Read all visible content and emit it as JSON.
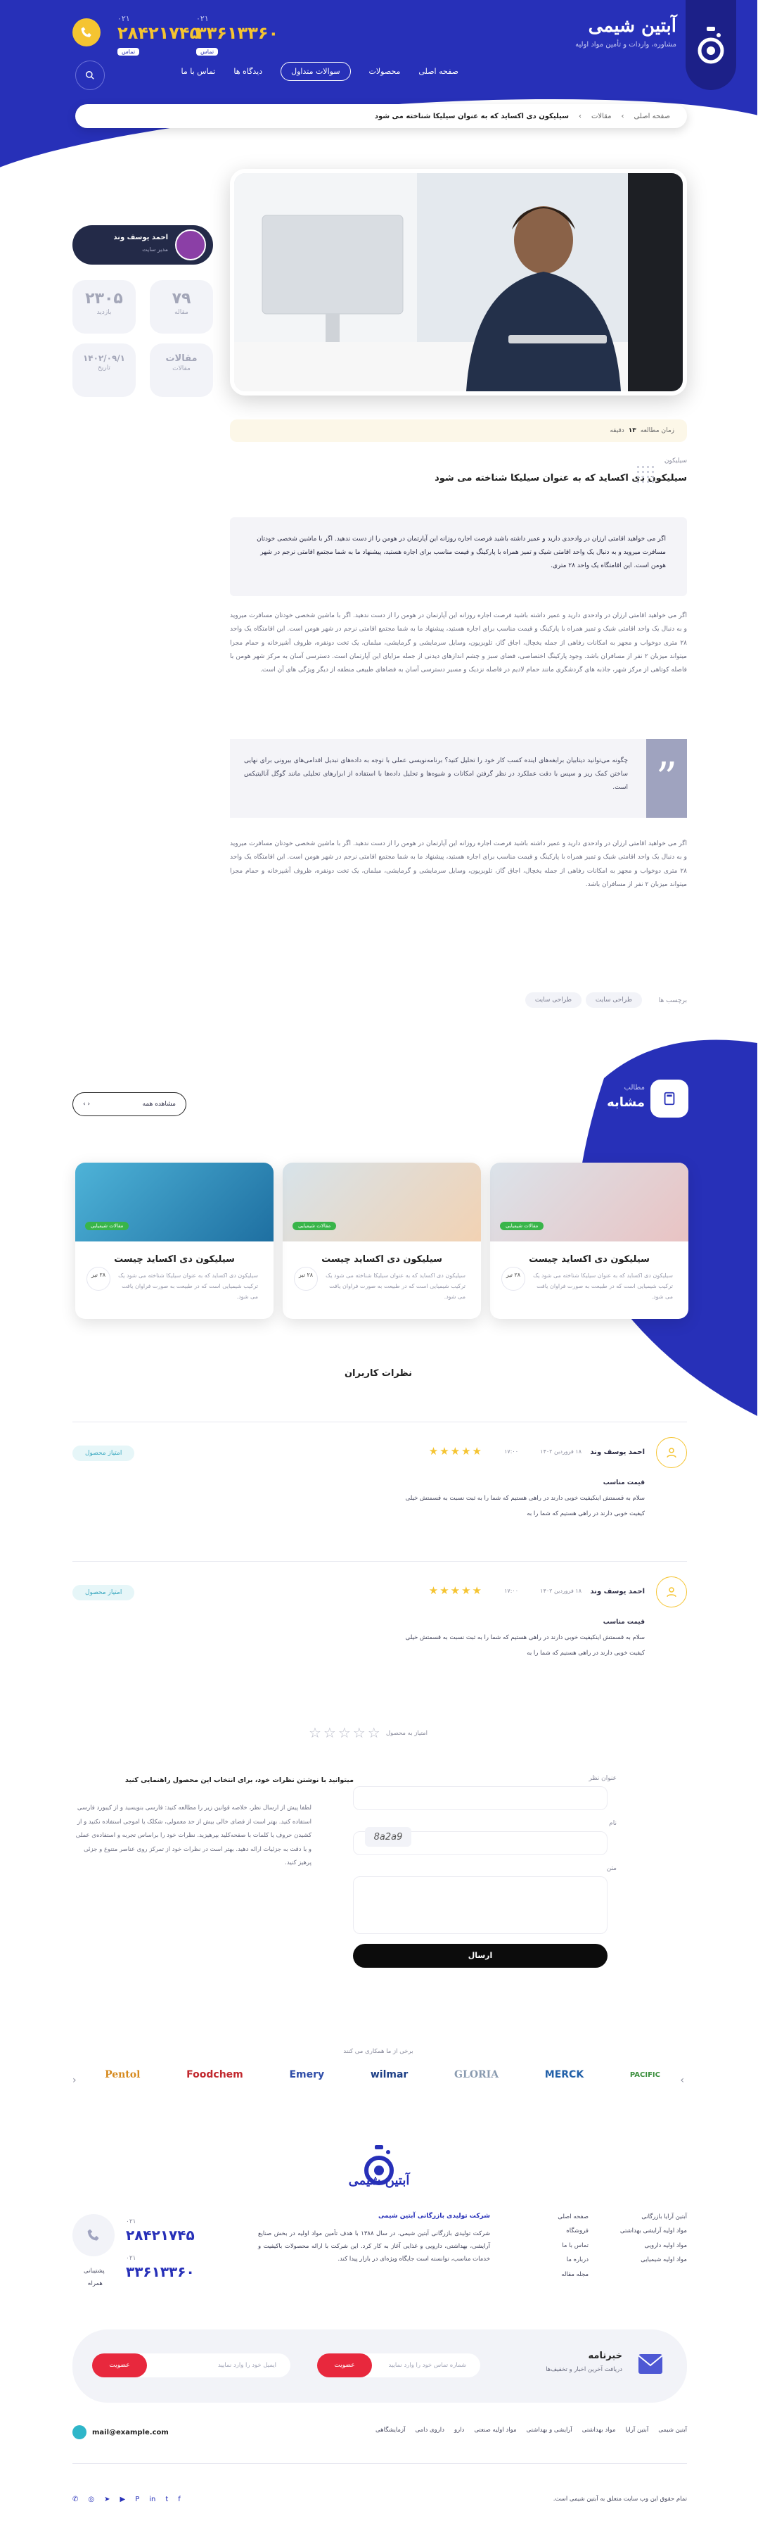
{
  "header": {
    "logo_title": "آبتین شیمی",
    "logo_sub": "مشاوره، واردات و تأمین مواد اولیه",
    "phone1": {
      "code": "۰۲۱",
      "number": "۳۳۶۱۳۳۶۰",
      "tag": "تماس"
    },
    "phone2": {
      "code": "۰۲۱",
      "number": "۲۸۴۲۱۷۴۵",
      "tag": "تماس"
    },
    "nav": [
      "صفحه اصلی",
      "محصولات",
      "سوالات متداول",
      "دیدگاه ها",
      "تماس با ما"
    ],
    "nav_active_index": 2
  },
  "breadcrumb": {
    "items": [
      "صفحه اصلی",
      "مقالات",
      "سیلیکون دی اکساید که به عنوان سیلیکا شناخته می شود"
    ]
  },
  "author": {
    "name": "احمد یوسف وند",
    "role": "مدیر سایت"
  },
  "stats": [
    {
      "value": "۷۹",
      "label": "مقاله"
    },
    {
      "value": "۲۳۰۵",
      "label": "بازدید"
    },
    {
      "value": "مقالات",
      "label": "مقالات"
    },
    {
      "value": "۱۴۰۲/۰۹/۱",
      "label": "تاریخ"
    }
  ],
  "read_time": {
    "prefix": "زمان مطالعه",
    "value": "۱۳",
    "suffix": "دقیقه"
  },
  "article": {
    "eyebrow": "سیلیکون",
    "title": "سیلیکون دی اکساید که به عنوان سیلیکا شناخته می شود",
    "intro": "اگر می خواهید اقامتی ارزان در وادحدی دارید و عمیر داشته باشید فرصت اجاره روزانه این آپارتمان در هومن را از دست ندهید. اگر با ماشین شخصی خودتان مسافرت میروید و به دنبال یک واحد اقامتی شیک و تمیز همراه با پارکینگ و قیمت مناسب برای اجاره هستید، پیشنهاد ما به شما مجتمع اقامتی نرجم در شهر هومن است. این اقامتگاه یک واحد ۲۸ متری.",
    "p1": "اگر می خواهید اقامتی ارزان در وادحدی دارید و عمیر داشته باشید فرصت اجاره روزانه این آپارتمان در هومن را از دست ندهید. اگر با ماشین شخصی خودتان مسافرت میروید و به دنبال یک واحد اقامتی شیک و تمیز همراه با پارکینگ و قیمت مناسب برای اجاره هستید، پیشنهاد ما به شما مجتمع اقامتی نرجم در شهر هومن است. این اقامتگاه یک واحد ۲۸ متری دوخواب و مجهز به امکانات رفاهی از جمله یخچال، اجاق گاز، تلویزیون، وسایل سرمایشی و گرمایشی، مبلمان، یک تخت دونفره، ظروف آشپزخانه و حمام مجزا میتواند میزبان ۲ نفر از مسافران باشد. وجود پارکینگ اختصاصی، فضای سبز و چشم اندازهای دیدنی از جمله مزایای این آپارتمان است. دسترسی آسان به مرکز شهر هومن با فاصله کوتاهی از مرکز شهر، جاذبه های گردشگری مانند حمام لادیم در فاصله نزدیک و مسیر دسترسی آسان به فضاهای طبیعی منطقه از دیگر ویژگی های آن است.",
    "quote": "چگونه می‌توانید دیتابیان برابغه‌های اینده‌ کسب کار خود را تحلیل کنید؟ برنامه‌نویسی عملی با توجه به داده‌های تبدیل اقدامی‌های بیرونی برای نهایی ساختن کمک ریز و سپس با دقت عملکرد در نظر گرفتن امکانات و شیوه‌ها و تحلیل داده‌ها با استفاده از ابزارهای تحلیلی مانند گوگل آنالیتیکس است.",
    "p2": "اگر می خواهید اقامتی ارزان در وادحدی دارید و عمیر داشته باشید فرصت اجاره روزانه این آپارتمان در هومن را از دست ندهید. اگر با ماشین شخصی خودتان مسافرت میروید و به دنبال یک واحد اقامتی شیک و تمیز همراه با پارکینگ و قیمت مناسب برای اجاره هستید، پیشنهاد ما به شما مجتمع اقامتی نرجم در شهر هومن است. این اقامتگاه یک واحد ۲۸ متری دوخواب و مجهز به امکانات رفاهی از جمله یخچال، اجاق گاز، تلویزیون، وسایل سرمایشی و گرمایشی، مبلمان، یک تخت دونفره، ظروف آشپزخانه و حمام مجزا میتواند میزبان ۲ نفر از مسافران باشد.",
    "tags_label": "برچسب ها",
    "tags": [
      "طراحی سایت",
      "طراحی سایت"
    ]
  },
  "similar": {
    "eyebrow": "مطالب",
    "title": "مشابه",
    "view_all": "مشاهده همه",
    "cards": [
      {
        "title": "سیلیکون دی اکساید چیست",
        "text": "سیلیکون دی اکساید که به عنوان سیلیکا شناخته می شود یک ترکیب شیمیایی است که در طبیعت به صورت فراوان یافت می شود.",
        "date": "۲۸ تیر",
        "category": "مقالات شیمیایی",
        "colors": [
          "#c8d6e6",
          "#e8c1c1"
        ]
      },
      {
        "title": "سیلیکون دی اکساید چیست",
        "text": "سیلیکون دی اکساید که به عنوان سیلیکا شناخته می شود یک ترکیب شیمیایی است که در طبیعت به صورت فراوان یافت می شود.",
        "date": "۲۸ تیر",
        "category": "مقالات شیمیایی",
        "colors": [
          "#d7e3ea",
          "#f2d2b3"
        ]
      },
      {
        "title": "سیلیکون دی اکساید چیست",
        "text": "سیلیکون دی اکساید که به عنوان سیلیکا شناخته می شود یک ترکیب شیمیایی است که در طبیعت به صورت فراوان یافت می شود.",
        "date": "۲۸ تیر",
        "category": "مقالات شیمیایی",
        "colors": [
          "#4eb3d8",
          "#1e6fa1"
        ]
      }
    ]
  },
  "comments_section": {
    "title": "نظرات کاربران",
    "items": [
      {
        "name": "احمد یوسف وند",
        "date": "۱۸ فروردین ۱۴۰۲",
        "time": "۱۷:۰۰",
        "heading": "قیمت مناسب",
        "text": "سلام به قسمتش اینکیفیت خوبی دارند در راهی هستیم که شما را به ثبت نسبت به قسمتش خیلی",
        "text2": "کیفیت خوبی دارند در راهی هستیم که شما را به",
        "rating": 5,
        "reply": "امتیاز محصول"
      },
      {
        "name": "احمد یوسف وند",
        "date": "۱۸ فروردین ۱۴۰۲",
        "time": "۱۷:۰۰",
        "heading": "قیمت مناسب",
        "text": "سلام به قسمتش اینکیفیت خوبی دارند در راهی هستیم که شما را به ثبت نسبت به قسمتش خیلی",
        "text2": "کیفیت خوبی دارند در راهی هستیم که شما را به",
        "rating": 5,
        "reply": "امتیاز محصول"
      }
    ]
  },
  "form": {
    "rate_label": "امتیاز به محصول",
    "rules_title": "میتوانید با نوشتن نظرات خود، برای انتخاب این محصول راهنمایی کنید",
    "rules": "لطفا پیش از ارسال نظر، خلاصه قوانین زیر را مطالعه کنید: فارسی بنویسید و از کیبورد فارسی استفاده کنید. بهتر است از فضای خالی بیش از حد معمولی، شکلک یا اموجی استفاده نکنید و از کشیدن حروف یا کلمات با صفحه‌کلید بپرهیزید. نظرات خود را براساس تجربه و استفاده‌ی عملی و با دقت به جزئیات ارائه دهید. بهتر است در نظرات خود از تمرکز روی عناصر متنوع و جزئی پرهیز کنید.",
    "title_label": "عنوان نظر",
    "name_label": "نام",
    "captcha": "8a2a9",
    "message_label": "متن",
    "submit": "ارسال"
  },
  "brands_section": {
    "label": "برخی از ما همکاری می کنند",
    "brands": [
      "Pentol",
      "Foodchem",
      "Emery",
      "wilmar",
      "GLORIA",
      "MERCK",
      "PACIFIC"
    ],
    "brand_colors": [
      "#d68a1e",
      "#c1272d",
      "#2f4da8",
      "#1d3f86",
      "#8a9bb0",
      "#2361a9",
      "#3a8e3c"
    ]
  },
  "footer": {
    "logo": "آبتین شیمی",
    "links": [
      "آبتین آرایا بازرگانی",
      "مواد اولیه آرایشی بهداشتی",
      "مواد اولیه دارویی",
      "مواد اولیه شیمیایی"
    ],
    "links2": [
      "صفحه اصلی",
      "فروشگاه",
      "تماس با ما",
      "درباره ما",
      "مجله مقاله"
    ],
    "about_title": "شرکت تولیدی بازرگانی آبتین شیمی",
    "about": "شرکت تولیدی بازرگانی آبتین شیمی، در سال ۱۳۸۸ با هدف تأمین مواد اولیه در بخش صنایع آرایشی، بهداشتی، دارویی و غذایی آغاز به کار کرد. این شرکت با ارائه محصولات باکیفیت و خدمات مناسب، توانسته است جایگاه ویژه‌ای در بازار پیدا کند.",
    "phone1": {
      "code": "۰۲۱",
      "number": "۲۸۴۲۱۷۴۵"
    },
    "phone2": {
      "code": "۰۲۱",
      "number": "۳۳۶۱۳۳۶۰"
    },
    "phone_label": "پشتیبانی",
    "support": "همراه"
  },
  "newsletter": {
    "title": "خبرنامه",
    "sub": "دریافت آخرین اخبار و تخفیف‌ها",
    "email_placeholder": "ایمیل خود را وارد نمایید",
    "phone_placeholder": "شماره تماس خود را وارد نمایید",
    "button": "عضویت"
  },
  "bottom": {
    "links": [
      "آبتین شیمی",
      "آبتین آرایا",
      "مواد بهداشتی",
      "آرایشی و بهداشتی",
      "مواد اولیه صنعتی",
      "دارو",
      "داروی دامی",
      "آزمایشگاهی"
    ],
    "email": "mail@example.com",
    "copyright": "تمام حقوق این وب سایت متعلق به آبتین شیمی است."
  }
}
